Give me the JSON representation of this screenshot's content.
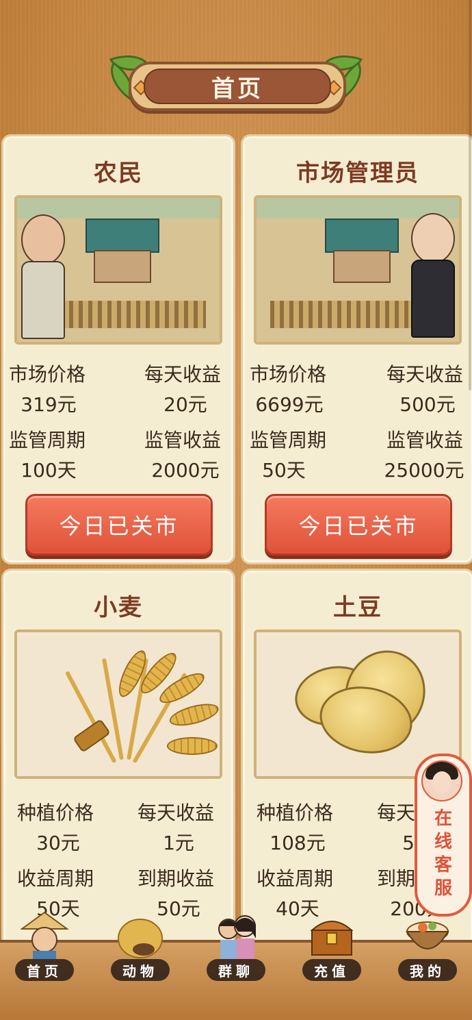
{
  "header": {
    "title": "首页"
  },
  "cards": [
    {
      "title": "农民",
      "image": "farmer-village-scene",
      "stats": [
        {
          "label": "市场价格",
          "value": "319元"
        },
        {
          "label": "每天收益",
          "value": "20元"
        },
        {
          "label": "监管周期",
          "value": "100天"
        },
        {
          "label": "监管收益",
          "value": "2000元"
        }
      ],
      "button": "今日已关市"
    },
    {
      "title": "市场管理员",
      "image": "market-manager-village-scene",
      "stats": [
        {
          "label": "市场价格",
          "value": "6699元"
        },
        {
          "label": "每天收益",
          "value": "500元"
        },
        {
          "label": "监管周期",
          "value": "50天"
        },
        {
          "label": "监管收益",
          "value": "25000元"
        }
      ],
      "button": "今日已关市"
    },
    {
      "title": "小麦",
      "image": "wheat-bundle",
      "stats": [
        {
          "label": "种植价格",
          "value": "30元"
        },
        {
          "label": "每天收益",
          "value": "1元"
        },
        {
          "label": "收益周期",
          "value": "50天"
        },
        {
          "label": "到期收益",
          "value": "50元"
        }
      ]
    },
    {
      "title": "土豆",
      "image": "potatoes",
      "stats": [
        {
          "label": "种植价格",
          "value": "108元"
        },
        {
          "label": "每天收益",
          "value": "5元"
        },
        {
          "label": "收益周期",
          "value": "40天"
        },
        {
          "label": "到期收益",
          "value": "200元"
        }
      ]
    }
  ],
  "service": {
    "label": [
      "在",
      "线",
      "客",
      "服"
    ],
    "icon": "customer-service-avatar"
  },
  "nav": [
    {
      "label": "首页",
      "icon": "farmer-hat-icon"
    },
    {
      "label": "动物",
      "icon": "haystack-icon"
    },
    {
      "label": "群聊",
      "icon": "couple-icon"
    },
    {
      "label": "充值",
      "icon": "treasure-chest-icon"
    },
    {
      "label": "我的",
      "icon": "food-bowl-icon"
    }
  ],
  "colors": {
    "accent": "#e0523a",
    "title": "#7c3a22",
    "card": "#f5edd2"
  }
}
